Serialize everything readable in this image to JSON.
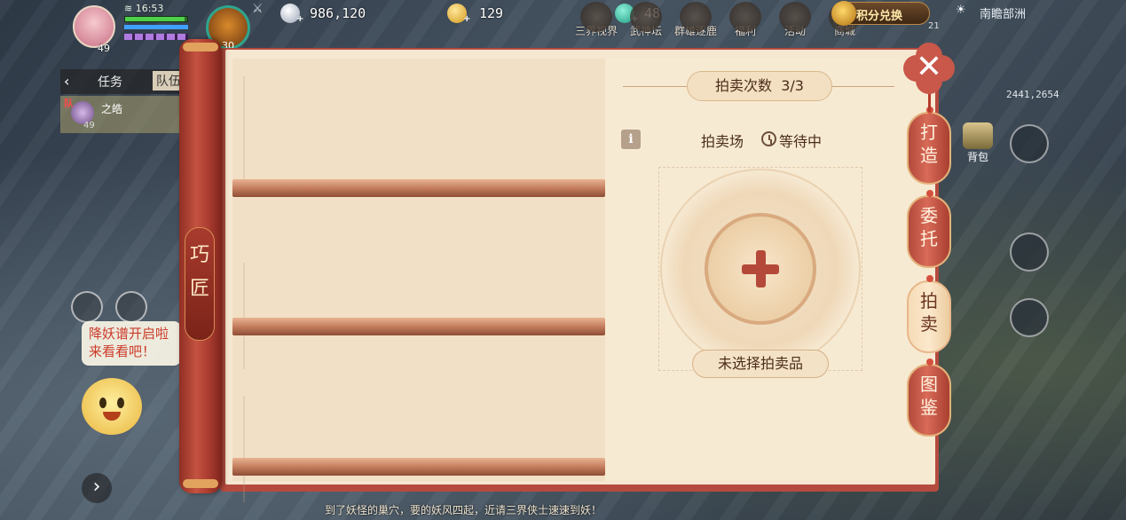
{
  "hud": {
    "time": "16:53",
    "player_level": "49",
    "pet_level": "30",
    "silver": "986,120",
    "gold": "129",
    "jade": "48",
    "menus": [
      "三界视界",
      "武神坛",
      "群雄逐鹿",
      "福利",
      "活动",
      "商城"
    ],
    "exchange_label": "积分兑换",
    "location": "南瞻部洲",
    "coords": "2441,2654",
    "small_number": "21",
    "bag_label": "背包"
  },
  "left_panel": {
    "tab_task": "任务",
    "tab_team": "队伍",
    "team_badge": "队",
    "team_member_name": "之皓",
    "team_member_level": "49",
    "speech_line1": "降妖谱开启啦",
    "speech_line2": "来看看吧！",
    "bottom_chat": "到了妖怪的巢穴，要的妖风四起，近请三界侠士速速到妖！"
  },
  "dialog": {
    "scroll_title_line1": "巧",
    "scroll_title_line2": "匠",
    "auction_count_label": "拍卖次数",
    "auction_count_value": "3/3",
    "info_icon": "i",
    "market_label": "拍卖场",
    "status_label": "等待中",
    "no_item_label": "未选择拍卖品",
    "close_label": "✕",
    "side_tabs": [
      {
        "line1": "打",
        "line2": "造"
      },
      {
        "line1": "委",
        "line2": "托"
      },
      {
        "line1": "拍",
        "line2": "卖"
      },
      {
        "line1": "图",
        "line2": "鉴"
      }
    ]
  },
  "colors": {
    "frame_red": "#b54b3e",
    "paper": "#f5e7d0",
    "accent_text": "#4b2d1a",
    "plus_red": "#b4493a"
  }
}
